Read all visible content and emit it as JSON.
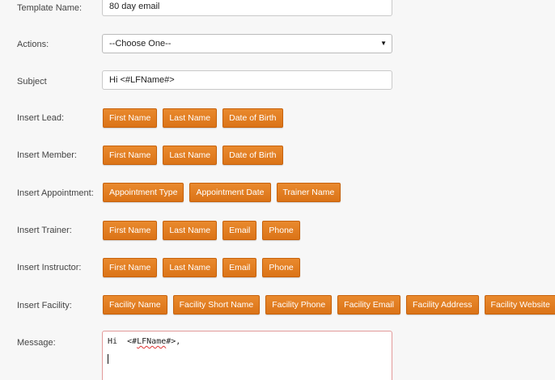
{
  "template_name": {
    "label": "Template Name:",
    "value": "80 day email"
  },
  "actions": {
    "label": "Actions:",
    "selected": "--Choose One--"
  },
  "subject": {
    "label": "Subject",
    "value": "Hi  <#LFName#>"
  },
  "insert_lead": {
    "label": "Insert Lead:",
    "buttons": [
      "First Name",
      "Last Name",
      "Date of Birth"
    ]
  },
  "insert_member": {
    "label": "Insert Member:",
    "buttons": [
      "First Name",
      "Last Name",
      "Date of Birth"
    ]
  },
  "insert_appointment": {
    "label": "Insert Appointment:",
    "buttons": [
      "Appointment Type",
      "Appointment Date",
      "Trainer Name"
    ]
  },
  "insert_trainer": {
    "label": "Insert Trainer:",
    "buttons": [
      "First Name",
      "Last Name",
      "Email",
      "Phone"
    ]
  },
  "insert_instructor": {
    "label": "Insert Instructor:",
    "buttons": [
      "First Name",
      "Last Name",
      "Email",
      "Phone"
    ]
  },
  "insert_facility": {
    "label": "Insert Facility:",
    "buttons": [
      "Facility Name",
      "Facility Short Name",
      "Facility Phone",
      "Facility Email",
      "Facility Address",
      "Facility Website"
    ]
  },
  "message": {
    "label": "Message:",
    "prefix": "Hi  <#",
    "token": "LFName",
    "suffix": "#>,"
  },
  "colors": {
    "button_orange": "#e07b20",
    "message_border": "#e39a9a"
  }
}
